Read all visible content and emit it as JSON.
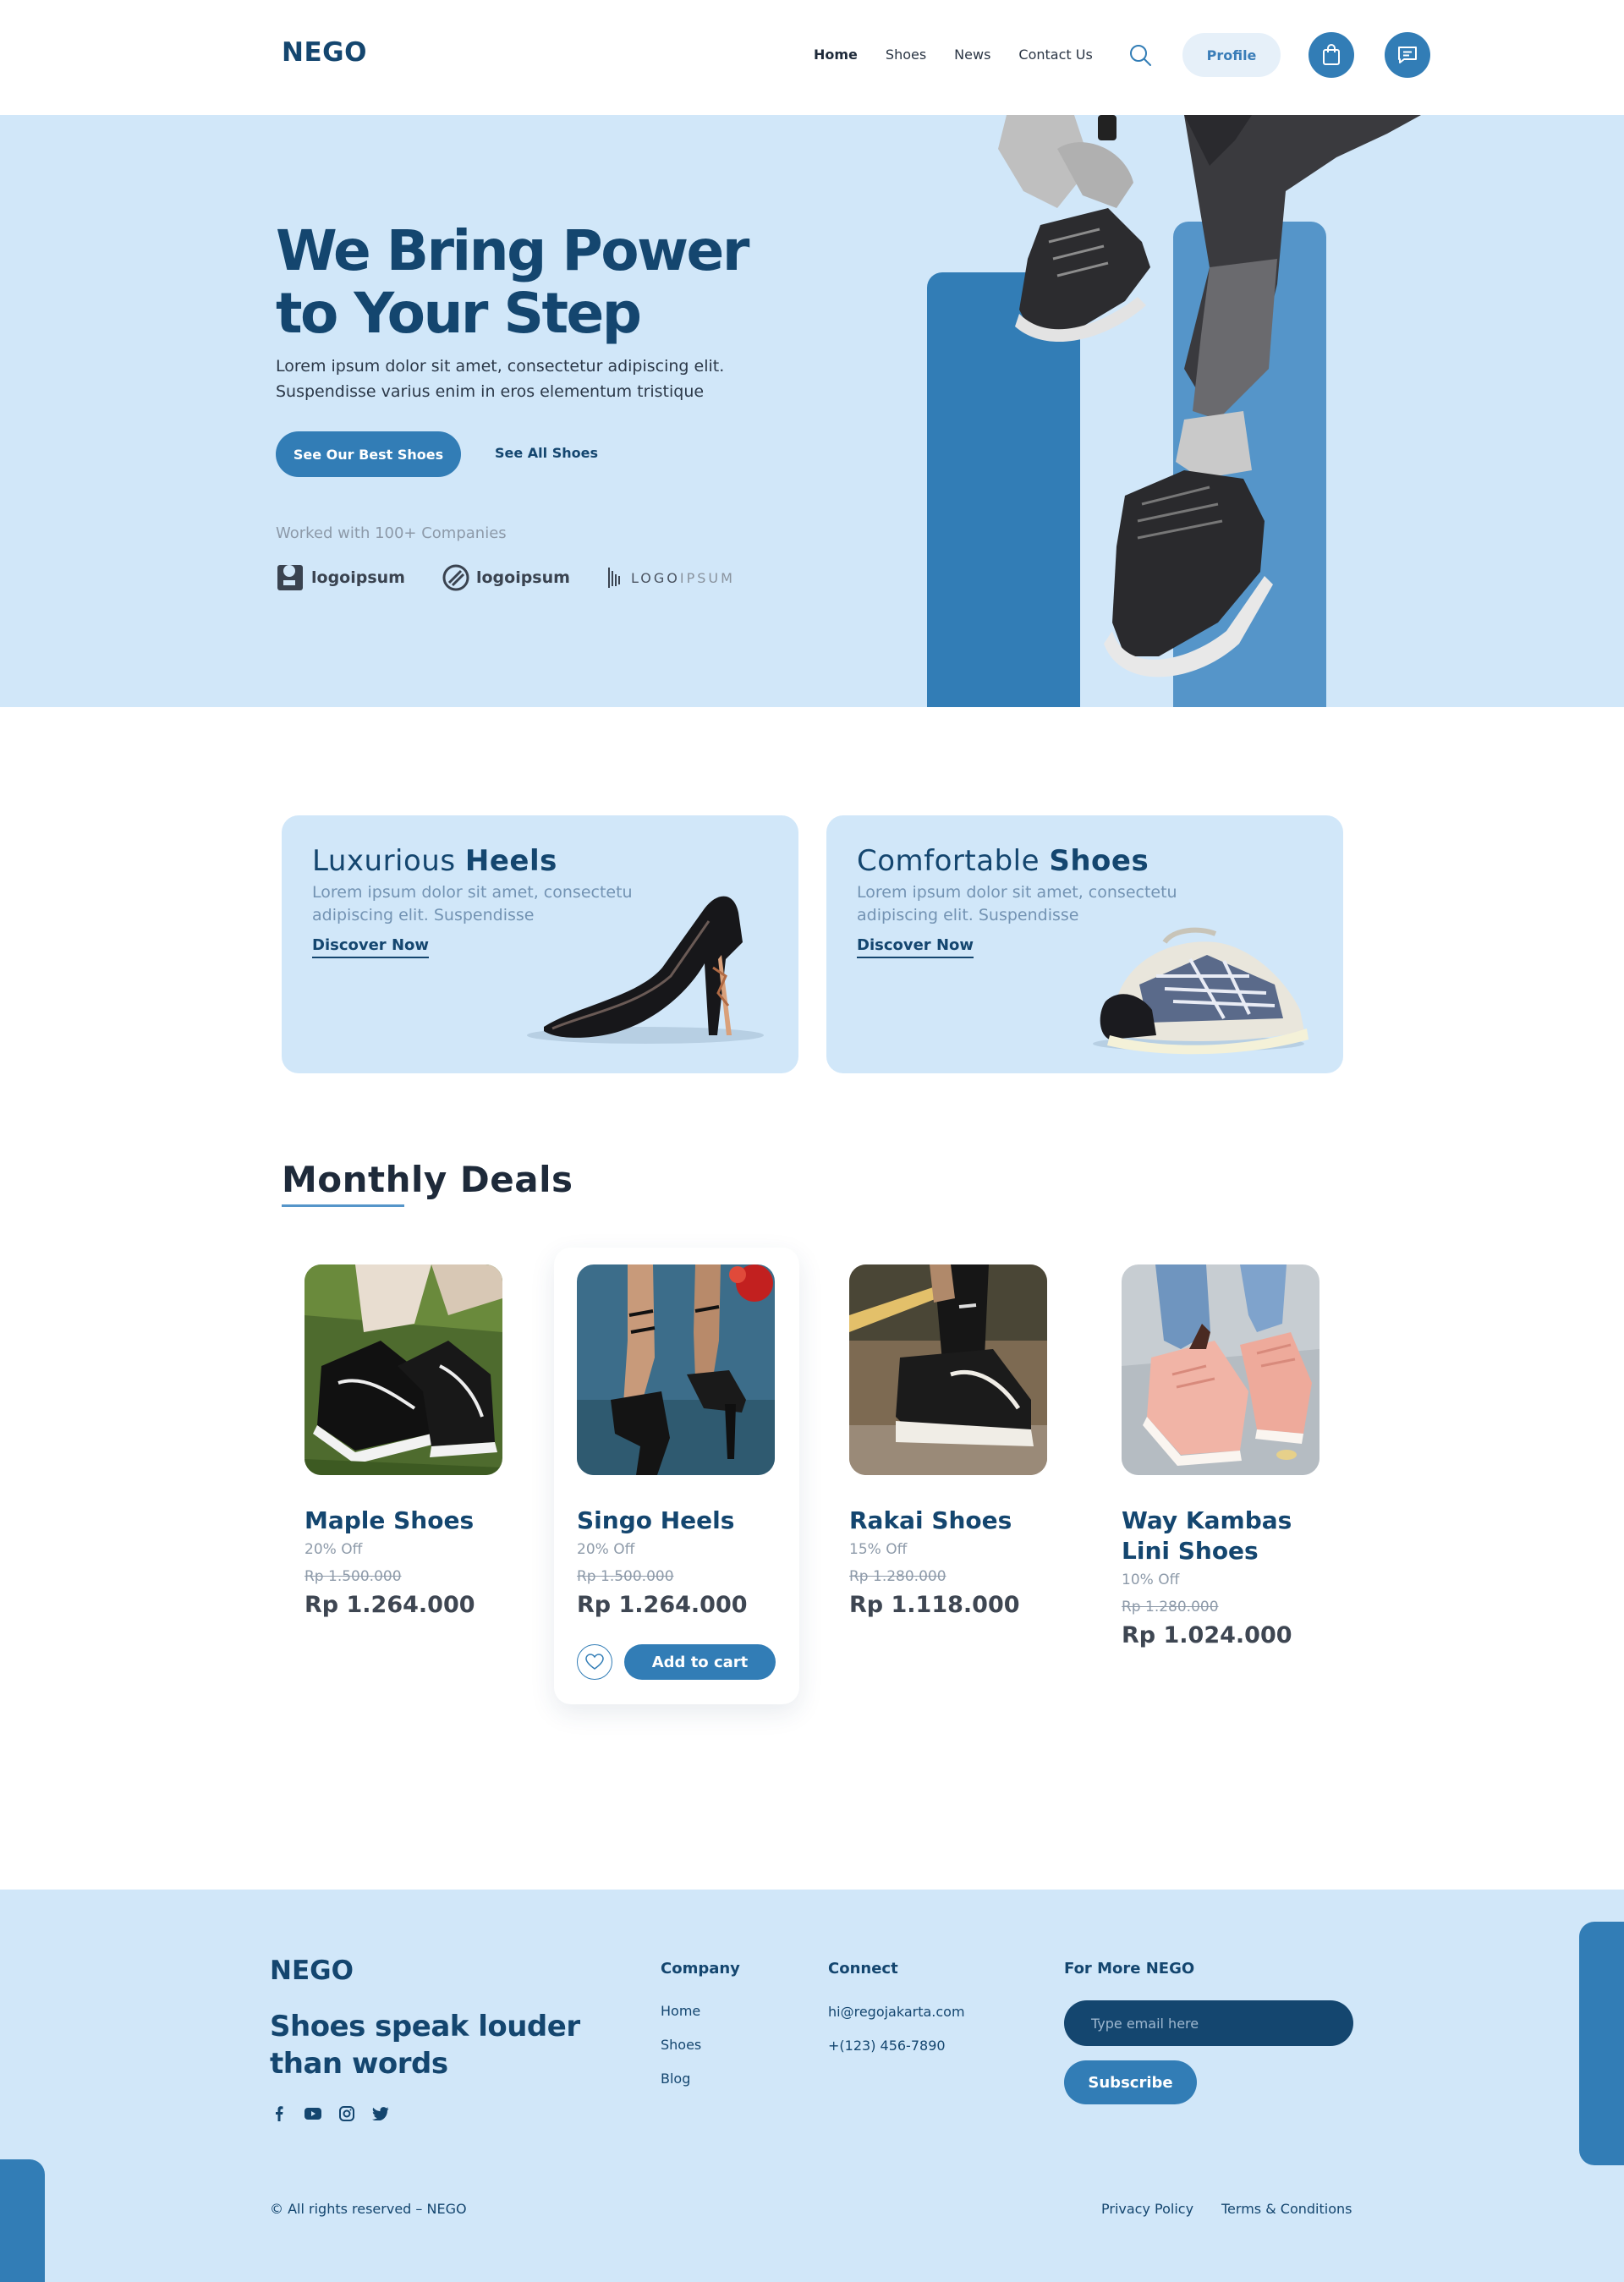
{
  "nav": {
    "logo": "NEGO",
    "links": [
      "Home",
      "Shoes",
      "News",
      "Contact Us"
    ],
    "profile": "Profile"
  },
  "hero": {
    "title": "We Bring Power to Your Step",
    "description": "Lorem ipsum dolor sit amet, consectetur adipiscing elit. Suspendisse varius enim in eros elementum tristique",
    "primary_button": "See Our Best Shoes",
    "secondary_button": "See All Shoes",
    "worked_with": "Worked with 100+ Companies",
    "partners": [
      "logoipsum",
      "logoipsum",
      "LOGO",
      "IPSUM"
    ]
  },
  "categories": [
    {
      "title_light": "Luxurious",
      "title_bold": "Heels",
      "description": "Lorem ipsum dolor sit amet, consectetu adipiscing elit. Suspendisse",
      "link": "Discover Now"
    },
    {
      "title_light": "Comfortable",
      "title_bold": "Shoes",
      "description": "Lorem ipsum dolor sit amet, consectetu adipiscing elit. Suspendisse",
      "link": "Discover Now"
    }
  ],
  "deals": {
    "title": "Monthly Deals",
    "products": [
      {
        "name": "Maple Shoes",
        "discount": "20% Off",
        "old_price": "Rp 1.500.000",
        "price": "Rp 1.264.000"
      },
      {
        "name": "Singo Heels",
        "discount": "20% Off",
        "old_price": "Rp 1.500.000",
        "price": "Rp 1.264.000",
        "add_to_cart": "Add to cart"
      },
      {
        "name": "Rakai Shoes",
        "discount": "15% Off",
        "old_price": "Rp 1.280.000",
        "price": "Rp 1.118.000"
      },
      {
        "name": "Way Kambas Lini Shoes",
        "discount": "10% Off",
        "old_price": "Rp 1.280.000",
        "price": "Rp 1.024.000"
      }
    ]
  },
  "footer": {
    "logo": "NEGO",
    "tagline": "Shoes speak louder than words",
    "company_heading": "Company",
    "company_links": [
      "Home",
      "Shoes",
      "Blog"
    ],
    "connect_heading": "Connect",
    "email": "hi@regojakarta.com",
    "phone": "+(123) 456-7890",
    "newsletter_heading": "For More NEGO",
    "email_placeholder": "Type email here",
    "subscribe": "Subscribe",
    "copyright": "© All rights reserved – NEGO",
    "privacy": "Privacy Policy",
    "terms": "Terms & Conditions"
  },
  "colors": {
    "primary": "#327db6",
    "navy": "#14466f",
    "light_blue": "#d1e7f9"
  }
}
